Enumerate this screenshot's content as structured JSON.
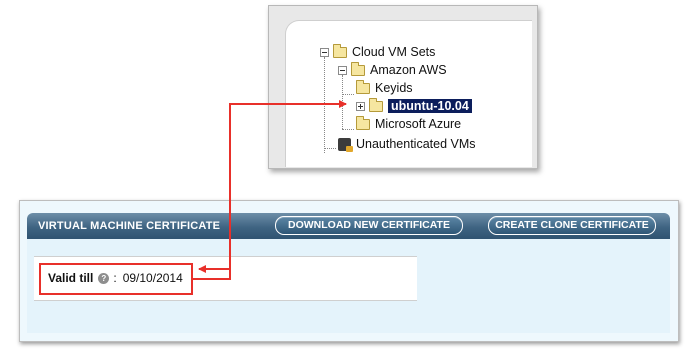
{
  "tree": {
    "items": [
      {
        "label": "Cloud VM Sets",
        "icon": "folder-icon",
        "expander": "minus"
      },
      {
        "label": "Amazon AWS",
        "icon": "folder-icon",
        "expander": "minus"
      },
      {
        "label": "Keyids",
        "icon": "folder-icon",
        "expander": "none"
      },
      {
        "label": "ubuntu-10.04",
        "icon": "folder-icon",
        "expander": "plus",
        "selected": true
      },
      {
        "label": "Microsoft Azure",
        "icon": "folder-icon",
        "expander": "none"
      },
      {
        "label": "Unauthenticated VMs",
        "icon": "locked-vm-icon",
        "expander": "none"
      }
    ]
  },
  "certificate": {
    "title": "VIRTUAL MACHINE CERTIFICATE",
    "download_button": "DOWNLOAD NEW CERTIFICATE",
    "clone_button": "CREATE CLONE CERTIFICATE",
    "valid_label": "Valid till",
    "help_icon": "?",
    "separator": ":",
    "valid_value": "09/10/2014"
  },
  "colors": {
    "annotation": "#e8302a",
    "selection": "#0c1e5c",
    "header": "#3f6482",
    "panel_bg": "#e4f3fb"
  }
}
